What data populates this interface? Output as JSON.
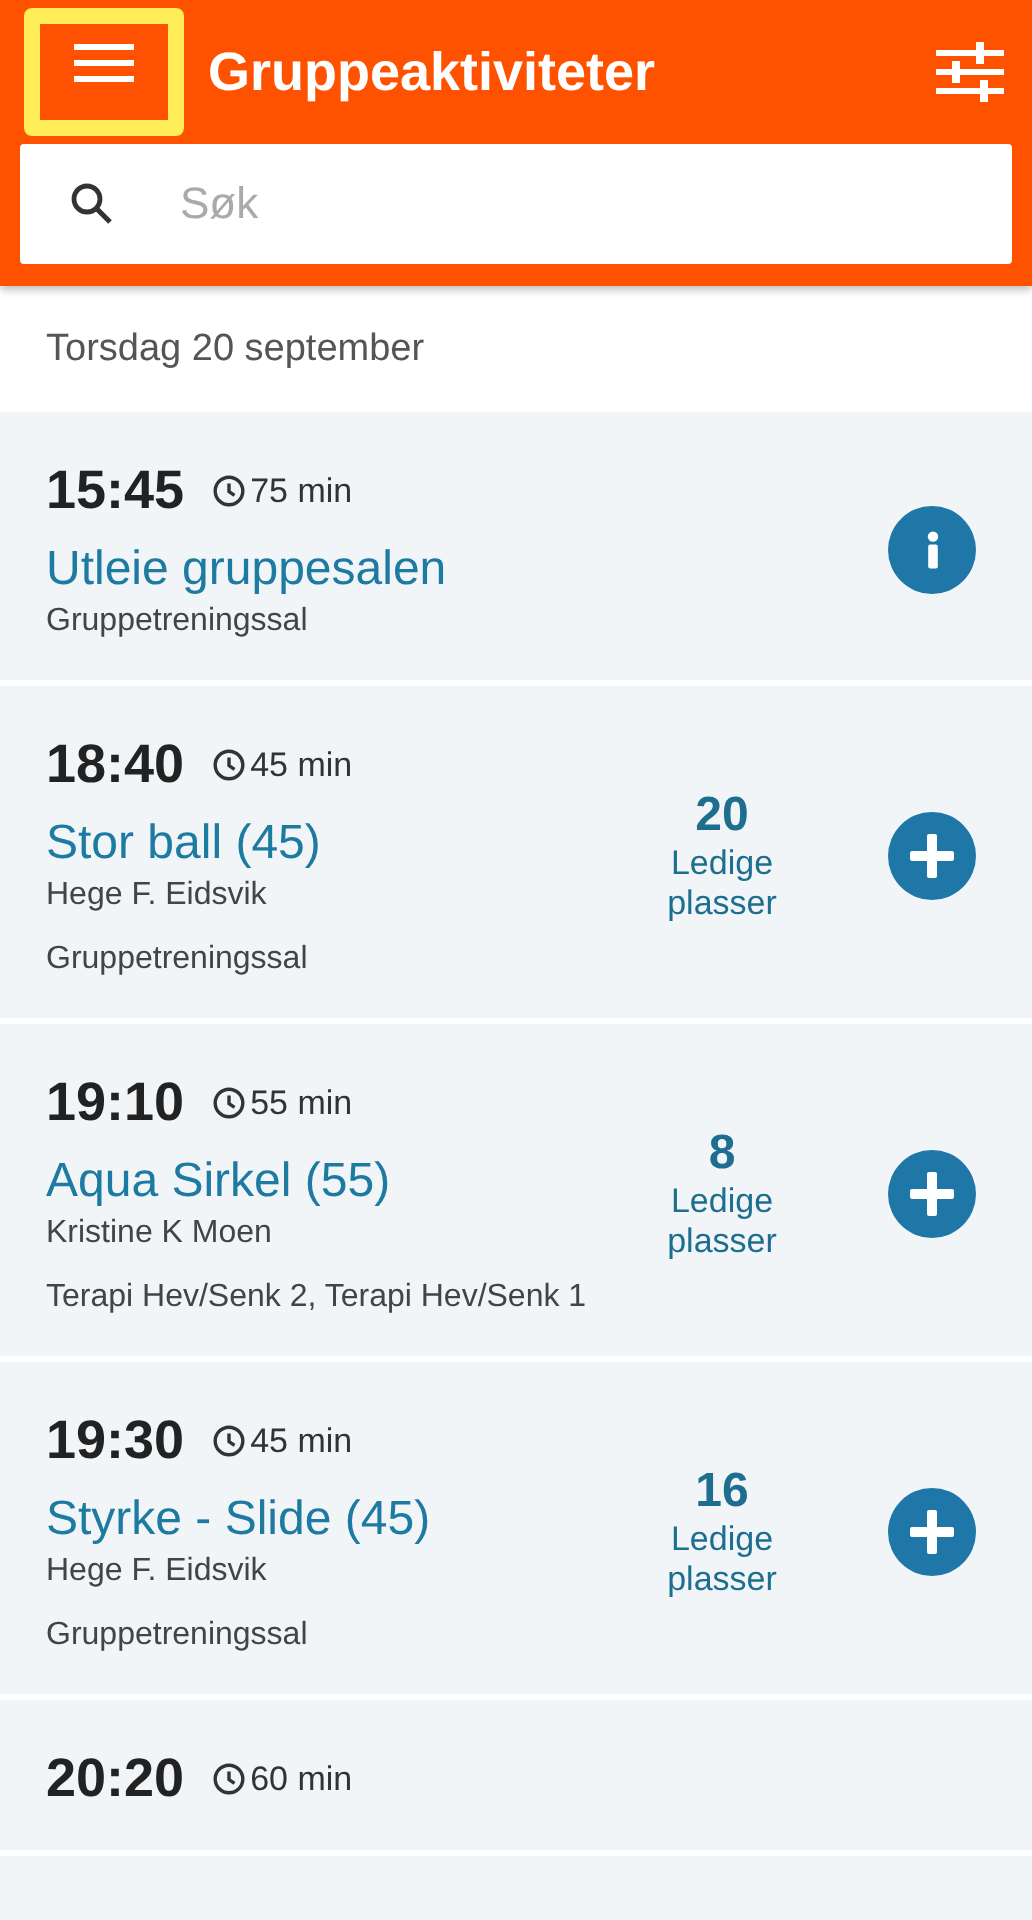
{
  "app_bar": {
    "title": "Gruppeaktiviteter",
    "menu_highlighted": true
  },
  "search": {
    "placeholder": "Søk"
  },
  "date_header": "Torsdag 20 september",
  "activities": [
    {
      "time": "15:45",
      "duration": "75 min",
      "title": "Utleie gruppesalen",
      "location": "Gruppetreningssal",
      "kind": "info"
    },
    {
      "time": "18:40",
      "duration": "45 min",
      "title": "Stor ball (45)",
      "instructor": "Hege F. Eidsvik",
      "location": "Gruppetreningssal",
      "spots": "20",
      "spots_label": "Ledige plasser",
      "kind": "add"
    },
    {
      "time": "19:10",
      "duration": "55 min",
      "title": "Aqua Sirkel (55)",
      "instructor": "Kristine K Moen",
      "location": "Terapi Hev/Senk 2, Terapi Hev/Senk 1",
      "spots": "8",
      "spots_label": "Ledige plasser",
      "kind": "add"
    },
    {
      "time": "19:30",
      "duration": "45 min",
      "title": "Styrke - Slide (45)",
      "instructor": "Hege F. Eidsvik",
      "location": "Gruppetreningssal",
      "spots": "16",
      "spots_label": "Ledige plasser",
      "kind": "add"
    },
    {
      "time": "20:20",
      "duration": "60 min"
    }
  ]
}
